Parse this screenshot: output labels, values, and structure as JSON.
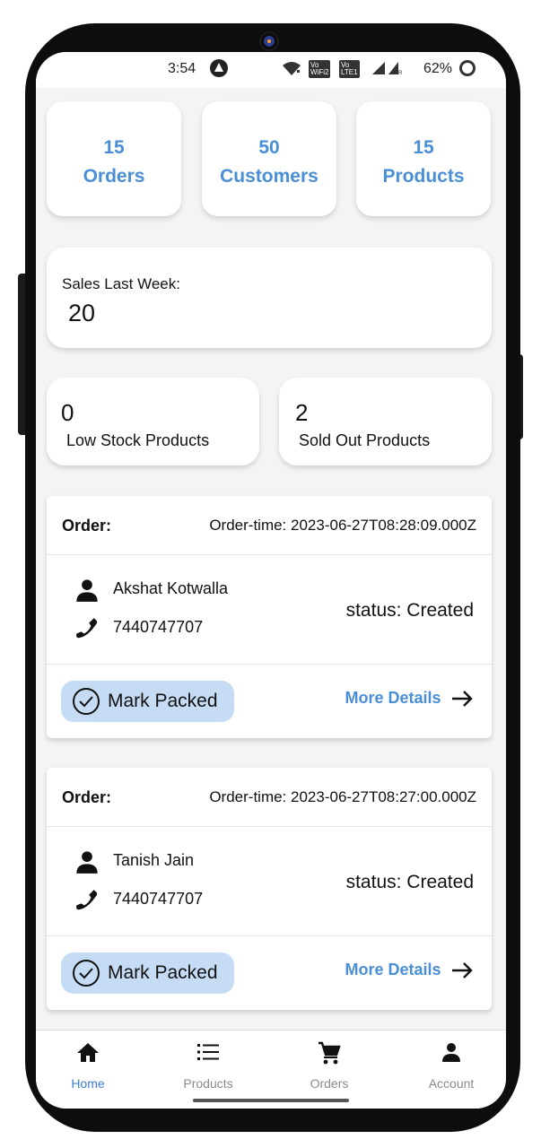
{
  "status_bar": {
    "time": "3:54",
    "battery": "62%",
    "volte_1": "Vo\nWiFi 2",
    "volte_2": "Vo\nLTE 1",
    "icons": [
      "alert-icon",
      "wifi-icon",
      "volte-wifi-icon",
      "volte-lte-icon",
      "signal-icon",
      "signal-roaming-icon",
      "battery-icon"
    ]
  },
  "stats": [
    {
      "value": "15",
      "label": "Orders"
    },
    {
      "value": "50",
      "label": "Customers"
    },
    {
      "value": "15",
      "label": "Products"
    }
  ],
  "sales": {
    "label": "Sales Last Week:",
    "value": "20"
  },
  "stock": [
    {
      "value": "0",
      "label": "Low Stock Products"
    },
    {
      "value": "2",
      "label": "Sold Out Products"
    }
  ],
  "orders": [
    {
      "order_label": "Order:",
      "order_time": "Order-time: 2023-06-27T08:28:09.000Z",
      "customer": "Akshat Kotwalla",
      "phone": "7440747707",
      "status": "status: Created",
      "mark_label": "Mark Packed",
      "more_label": "More Details"
    },
    {
      "order_label": "Order:",
      "order_time": "Order-time: 2023-06-27T08:27:00.000Z",
      "customer": "Tanish Jain",
      "phone": "7440747707",
      "status": "status: Created",
      "mark_label": "Mark Packed",
      "more_label": "More Details"
    }
  ],
  "nav": [
    {
      "label": "Home",
      "icon": "home-icon",
      "active": true
    },
    {
      "label": "Products",
      "icon": "list-icon",
      "active": false
    },
    {
      "label": "Orders",
      "icon": "cart-icon",
      "active": false
    },
    {
      "label": "Account",
      "icon": "person-icon",
      "active": false
    }
  ],
  "colors": {
    "accent": "#4a8fd6",
    "mark_button_bg": "#c6dcf5",
    "nav_active": "#3a7fd0",
    "nav_inactive": "#8a8a8a",
    "background": "#f4f4f4"
  }
}
